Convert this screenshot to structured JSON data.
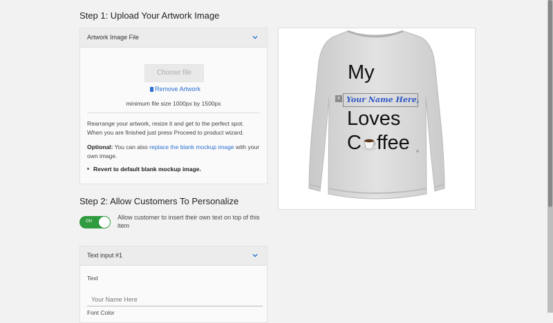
{
  "step1": {
    "heading": "Step 1: Upload Your Artwork Image",
    "panel_title": "Artwork Image File",
    "choose_file_label": "Choose file",
    "remove_artwork_label": "Remove Artwork",
    "min_size_text": "minimum file size 1000px by 1500px",
    "instructions": "Rearrange your artwork, resize it and get to the perfect spot. When you are finished just press Proceed to product wizard.",
    "optional_label": "Optional:",
    "optional_text_pre": "You can also",
    "optional_link": "replace the blank mockup image",
    "optional_text_post": "with your own image.",
    "revert_label": "Revert to default blank mockup image."
  },
  "step2": {
    "heading": "Step 2: Allow Customers To Personalize",
    "toggle_state": "ON",
    "toggle_description": "Allow customer to insert their own text on top of this item",
    "text_input_panel_title": "Text input #1",
    "text_label": "Text",
    "text_placeholder": "Your Name Here",
    "font_color_label": "Font Color"
  },
  "preview": {
    "line1": "My",
    "name_text": "Your Name Here,",
    "line3": "Loves",
    "line4_pre": "C",
    "line4_post": "ffee",
    "close_glyph": "x"
  },
  "colors": {
    "accent": "#2a6fd0",
    "toggle_on": "#2e9b3e",
    "name_text": "#2f58c4"
  }
}
